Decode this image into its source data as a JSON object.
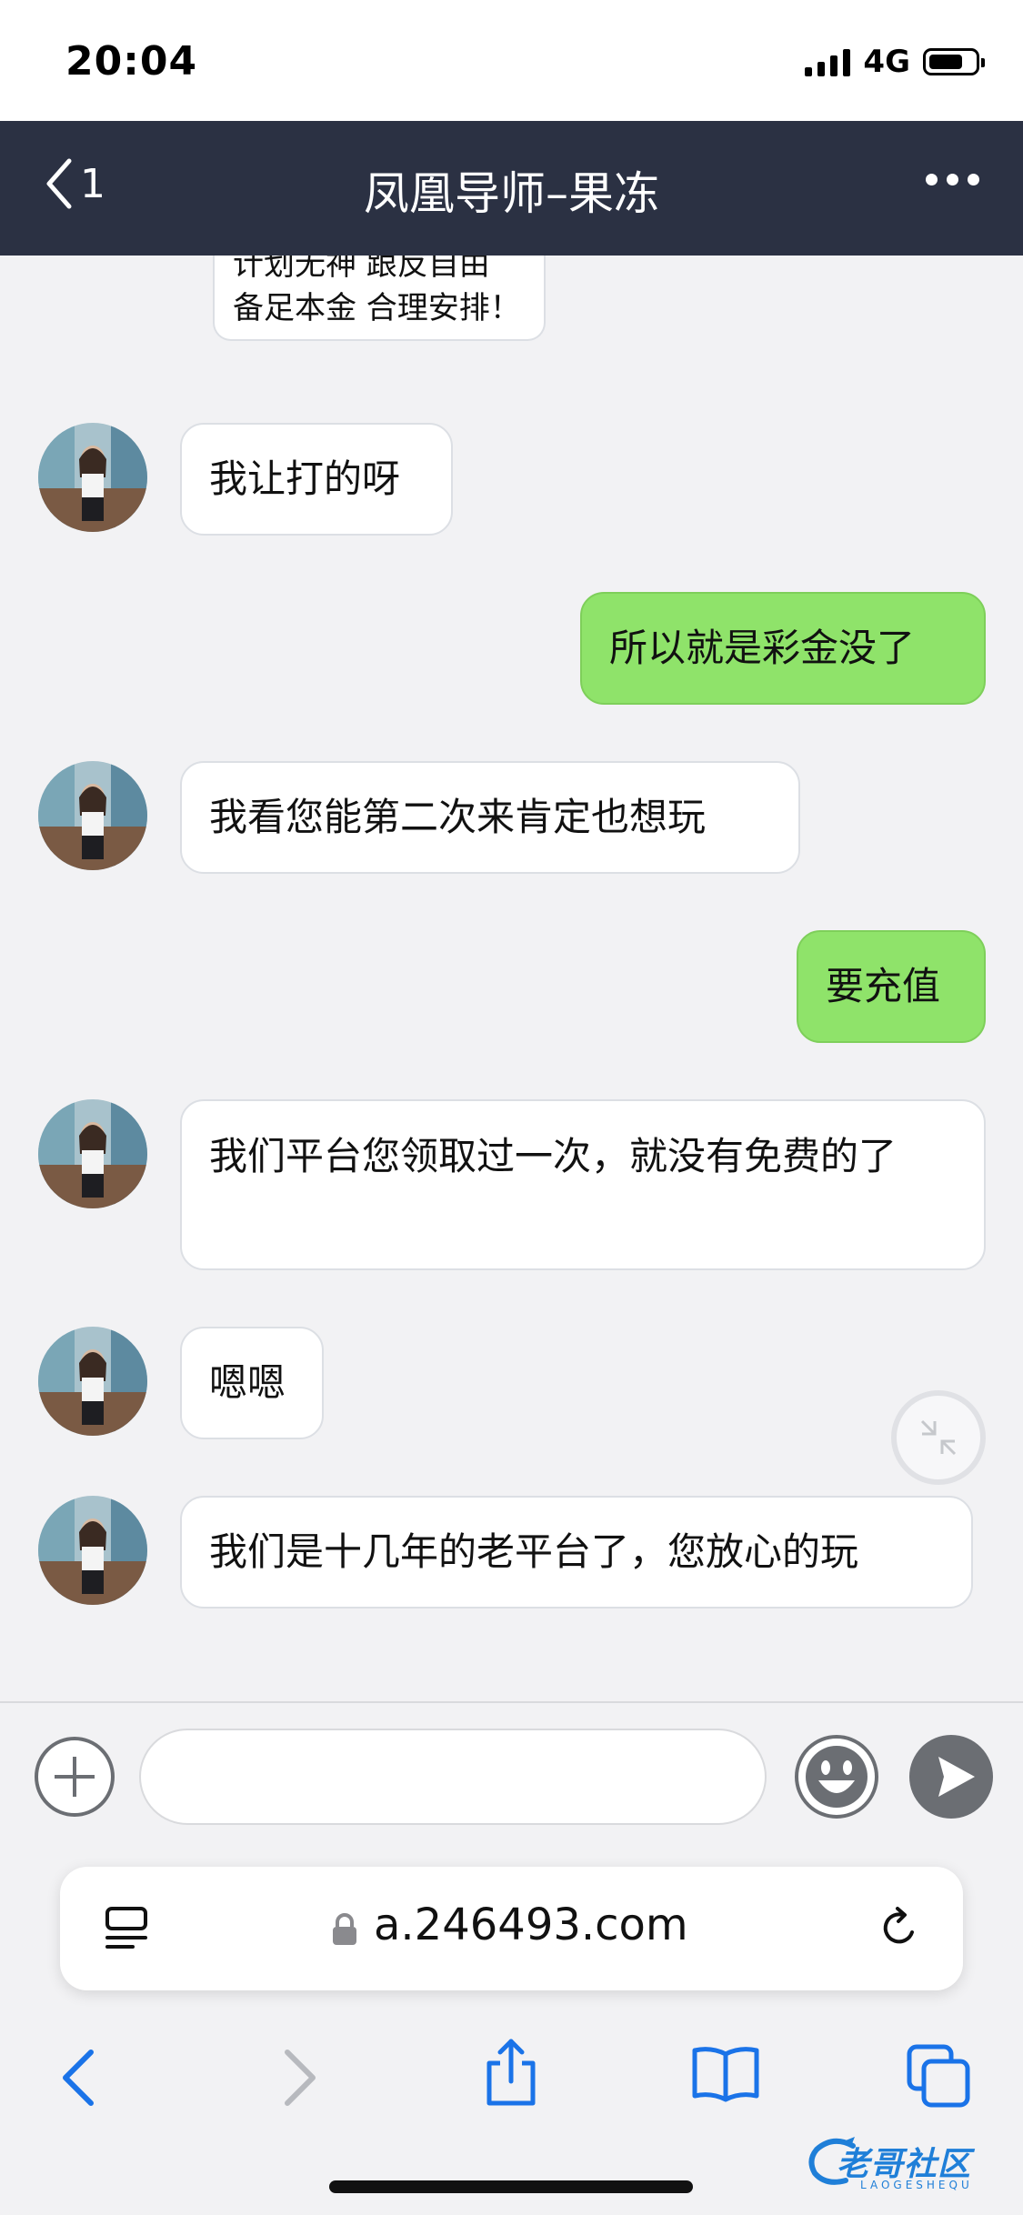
{
  "status": {
    "time": "20:04",
    "network": "4G"
  },
  "header": {
    "back_count": "1",
    "title": "凤凰导师–果冻"
  },
  "messages": [
    {
      "dir": "in",
      "text": "计划无神 跟反自由\n备足本金 合理安排！"
    },
    {
      "dir": "in",
      "text": "我让打的呀"
    },
    {
      "dir": "out",
      "text": "所以就是彩金没了"
    },
    {
      "dir": "in",
      "text": "我看您能第二次来肯定也想玩"
    },
    {
      "dir": "out",
      "text": "要充值"
    },
    {
      "dir": "in",
      "text": "我们平台您领取过一次，就没有免费的了"
    },
    {
      "dir": "in",
      "text": "嗯嗯"
    },
    {
      "dir": "in",
      "text": "我们是十几年的老平台了，您放心的玩"
    }
  ],
  "input": {
    "placeholder": ""
  },
  "browser": {
    "url": "a.246493.com"
  },
  "watermark": {
    "text": "老哥社区",
    "sub": "LAOGESHEQU"
  },
  "colors": {
    "header_bg": "#2b3143",
    "outgoing_bubble": "#8fe36a",
    "ios_blue": "#1a73e8"
  }
}
